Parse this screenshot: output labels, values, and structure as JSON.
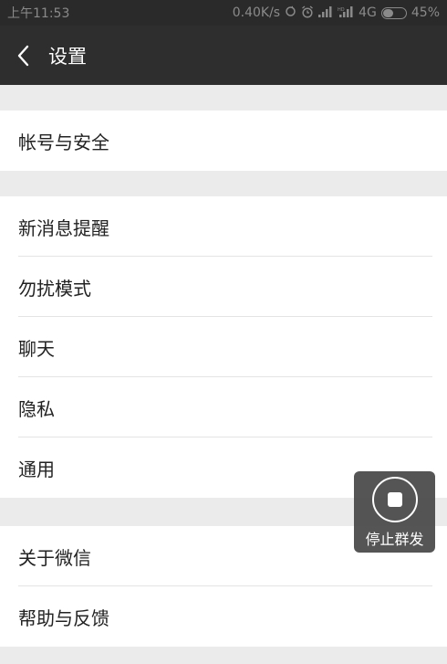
{
  "status_bar": {
    "time": "上午11:53",
    "network_speed": "0.40K/s",
    "network_type": "4G",
    "battery_percent": "45%",
    "battery_level": 0.45,
    "icons": [
      "sync-icon",
      "alarm-icon",
      "signal-icon",
      "hd-signal-icon",
      "battery-icon"
    ]
  },
  "header": {
    "title": "设置",
    "back_icon": "chevron-left-icon"
  },
  "groups": [
    {
      "items": [
        {
          "label": "帐号与安全"
        }
      ]
    },
    {
      "items": [
        {
          "label": "新消息提醒"
        },
        {
          "label": "勿扰模式"
        },
        {
          "label": "聊天"
        },
        {
          "label": "隐私"
        },
        {
          "label": "通用"
        }
      ]
    },
    {
      "items": [
        {
          "label": "关于微信"
        },
        {
          "label": "帮助与反馈"
        }
      ]
    }
  ],
  "floating_control": {
    "label": "停止群发",
    "icon": "stop-icon"
  },
  "colors": {
    "header_bg": "#2e2e2e",
    "page_bg": "#ebebeb",
    "item_bg": "#ffffff",
    "text": "#222222"
  }
}
